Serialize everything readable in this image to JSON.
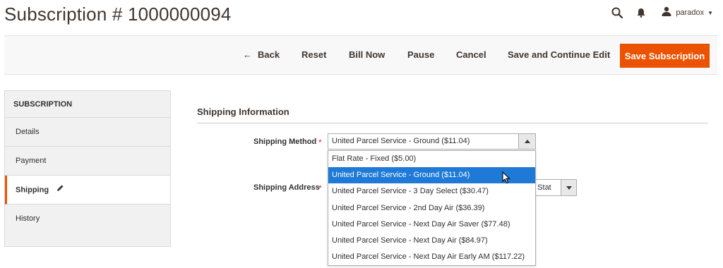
{
  "page": {
    "title": "Subscription # 1000000094"
  },
  "header": {
    "user_name": "paradox"
  },
  "actions": {
    "back": "Back",
    "reset": "Reset",
    "bill_now": "Bill Now",
    "pause": "Pause",
    "cancel": "Cancel",
    "save_continue": "Save and Continue Edit",
    "save": "Save Subscription"
  },
  "sidebar": {
    "heading": "SUBSCRIPTION",
    "items": [
      {
        "label": "Details",
        "active": false
      },
      {
        "label": "Payment",
        "active": false
      },
      {
        "label": "Shipping",
        "active": true
      },
      {
        "label": "History",
        "active": false
      }
    ]
  },
  "section": {
    "title": "Shipping Information"
  },
  "form": {
    "shipping_method": {
      "label": "Shipping Method",
      "value": "United Parcel Service - Ground ($11.04)",
      "options": [
        "Flat Rate - Fixed ($5.00)",
        "United Parcel Service - Ground ($11.04)",
        "United Parcel Service - 3 Day Select ($30.47)",
        "United Parcel Service - 2nd Day Air ($36.39)",
        "United Parcel Service - Next Day Air Saver ($77.48)",
        "United Parcel Service - Next Day Air ($84.97)",
        "United Parcel Service - Next Day Air Early AM ($117.22)"
      ],
      "selected_index": 1
    },
    "shipping_address": {
      "label": "Shipping Address",
      "visible_value": "d Stat"
    },
    "required_mark": "*"
  },
  "colors": {
    "accent": "#eb5202",
    "selected": "#1e7ad6",
    "required": "#e22626"
  },
  "icons": {
    "search": "search-icon",
    "notifications": "bell-icon",
    "user": "user-icon",
    "edit": "pencil-icon",
    "back": "back-arrow-icon"
  }
}
